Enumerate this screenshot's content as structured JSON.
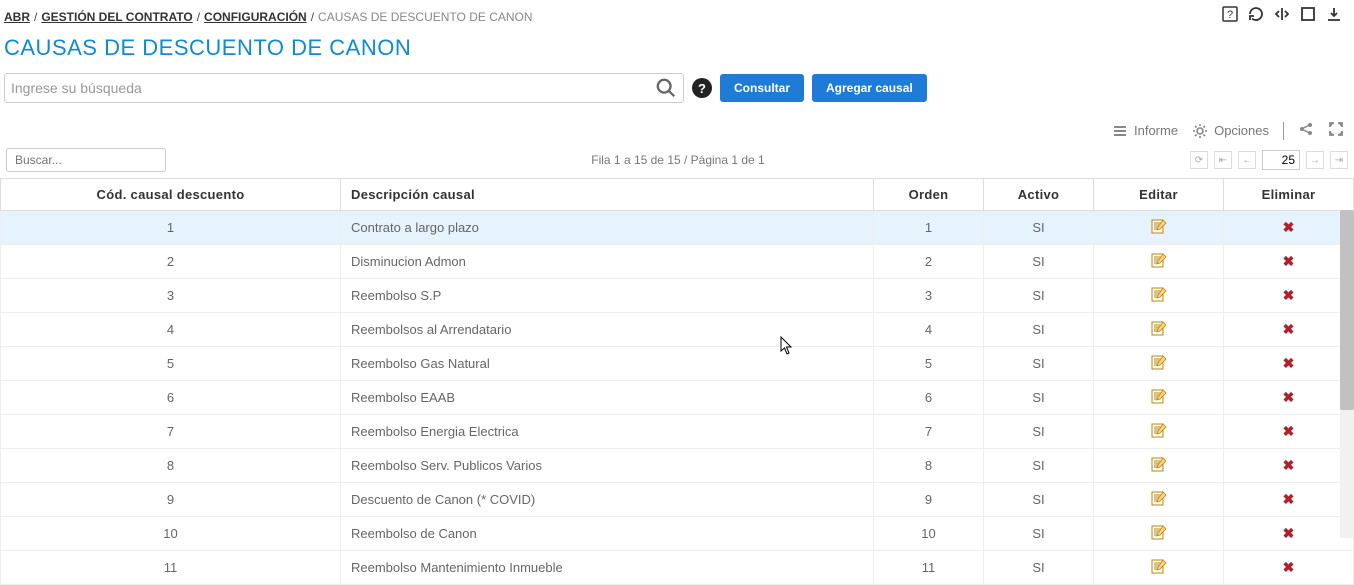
{
  "breadcrumb": {
    "items": [
      "ABR",
      "GESTIÓN DEL CONTRATO",
      "CONFIGURACIÓN"
    ],
    "current": "CAUSAS DE DESCUENTO DE CANON"
  },
  "page_title": "CAUSAS DE DESCUENTO DE CANON",
  "search": {
    "placeholder": "Ingrese su búsqueda",
    "help_icon": "?",
    "btn_consultar": "Consultar",
    "btn_agregar": "Agregar causal"
  },
  "toolbar2": {
    "informe": "Informe",
    "opciones": "Opciones"
  },
  "grid": {
    "mini_search_placeholder": "Buscar...",
    "info": "Fila 1 a 15 de 15 / Página 1 de 1",
    "page_size": "25",
    "headers": {
      "cod": "Cód. causal descuento",
      "desc": "Descripción causal",
      "orden": "Orden",
      "activo": "Activo",
      "editar": "Editar",
      "eliminar": "Eliminar"
    },
    "rows": [
      {
        "cod": "1",
        "desc": "Contrato a largo plazo",
        "orden": "1",
        "activo": "SI"
      },
      {
        "cod": "2",
        "desc": "Disminucion Admon",
        "orden": "2",
        "activo": "SI"
      },
      {
        "cod": "3",
        "desc": "Reembolso S.P",
        "orden": "3",
        "activo": "SI"
      },
      {
        "cod": "4",
        "desc": "Reembolsos al Arrendatario",
        "orden": "4",
        "activo": "SI"
      },
      {
        "cod": "5",
        "desc": "Reembolso Gas Natural",
        "orden": "5",
        "activo": "SI"
      },
      {
        "cod": "6",
        "desc": "Reembolso EAAB",
        "orden": "6",
        "activo": "SI"
      },
      {
        "cod": "7",
        "desc": "Reembolso Energia Electrica",
        "orden": "7",
        "activo": "SI"
      },
      {
        "cod": "8",
        "desc": "Reembolso Serv. Publicos Varios",
        "orden": "8",
        "activo": "SI"
      },
      {
        "cod": "9",
        "desc": "Descuento de Canon (* COVID)",
        "orden": "9",
        "activo": "SI"
      },
      {
        "cod": "10",
        "desc": "Reembolso de Canon",
        "orden": "10",
        "activo": "SI"
      },
      {
        "cod": "11",
        "desc": "Reembolso Mantenimiento Inmueble",
        "orden": "11",
        "activo": "SI"
      }
    ]
  }
}
